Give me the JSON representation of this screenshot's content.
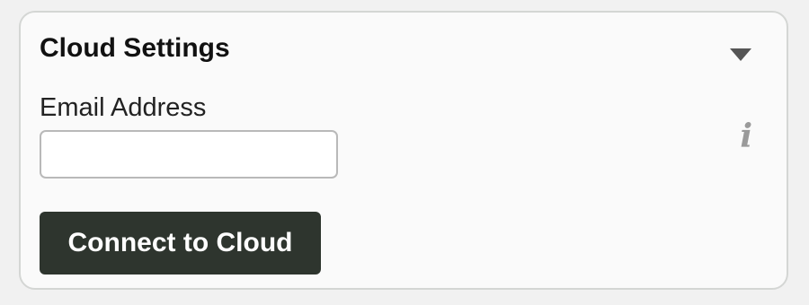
{
  "panel": {
    "title": "Cloud Settings",
    "toggle_icon": "caret-down-icon"
  },
  "email": {
    "label": "Email Address",
    "value": "",
    "placeholder": ""
  },
  "info_icon": {
    "glyph": "i",
    "icon": "info-icon"
  },
  "actions": {
    "connect_label": "Connect to Cloud"
  },
  "colors": {
    "button_bg": "#2e352e",
    "panel_border": "#d4d6d4",
    "icon_gray": "#9a9a9a"
  }
}
